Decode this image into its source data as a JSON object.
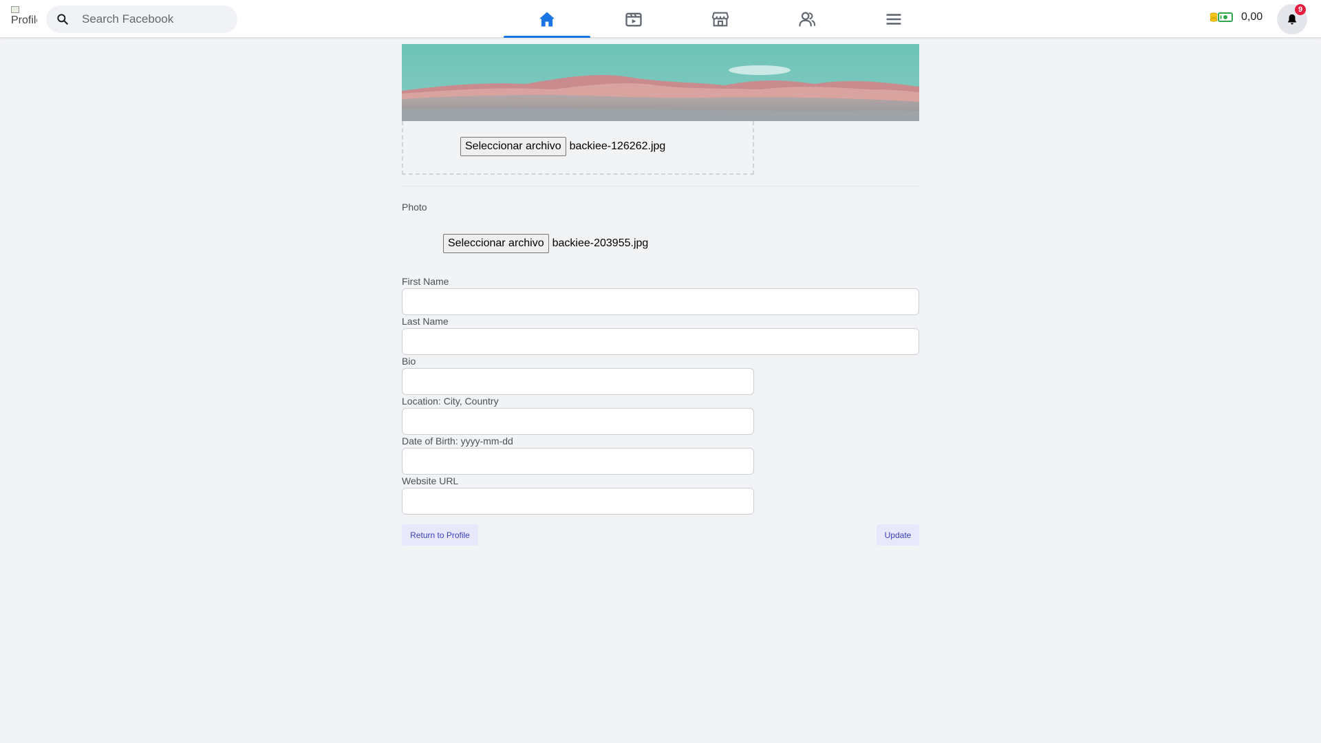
{
  "header": {
    "logo_alt": "Profile",
    "search_placeholder": "Search Facebook",
    "nav_tabs": [
      {
        "name": "home",
        "icon": "home-icon",
        "active": true
      },
      {
        "name": "watch",
        "icon": "video-icon",
        "active": false
      },
      {
        "name": "marketplace",
        "icon": "store-icon",
        "active": false
      },
      {
        "name": "friends",
        "icon": "friends-icon",
        "active": false
      },
      {
        "name": "menu",
        "icon": "menu-icon",
        "active": false
      }
    ],
    "wallet_amount": "0,00",
    "notification_count": "9"
  },
  "cover": {
    "file_button": "Seleccionar archivo",
    "file_name": "backiee-126262.jpg"
  },
  "photo": {
    "label": "Photo",
    "file_button": "Seleccionar archivo",
    "file_name": "backiee-203955.jpg"
  },
  "form": {
    "first_name_label": "First Name",
    "last_name_label": "Last Name",
    "bio_label": "Bio",
    "location_label": "Location: City, Country",
    "dob_label": "Date of Birth: yyyy-mm-dd",
    "website_label": "Website URL",
    "first_name_value": "",
    "last_name_value": "",
    "bio_value": "",
    "location_value": "",
    "dob_value": "",
    "website_value": ""
  },
  "actions": {
    "return_label": "Return to Profile",
    "update_label": "Update"
  },
  "colors": {
    "accent": "#1b74e4",
    "button_bg": "#e7e8fc",
    "button_text": "#3b3fb5",
    "badge": "#e41e3f"
  }
}
